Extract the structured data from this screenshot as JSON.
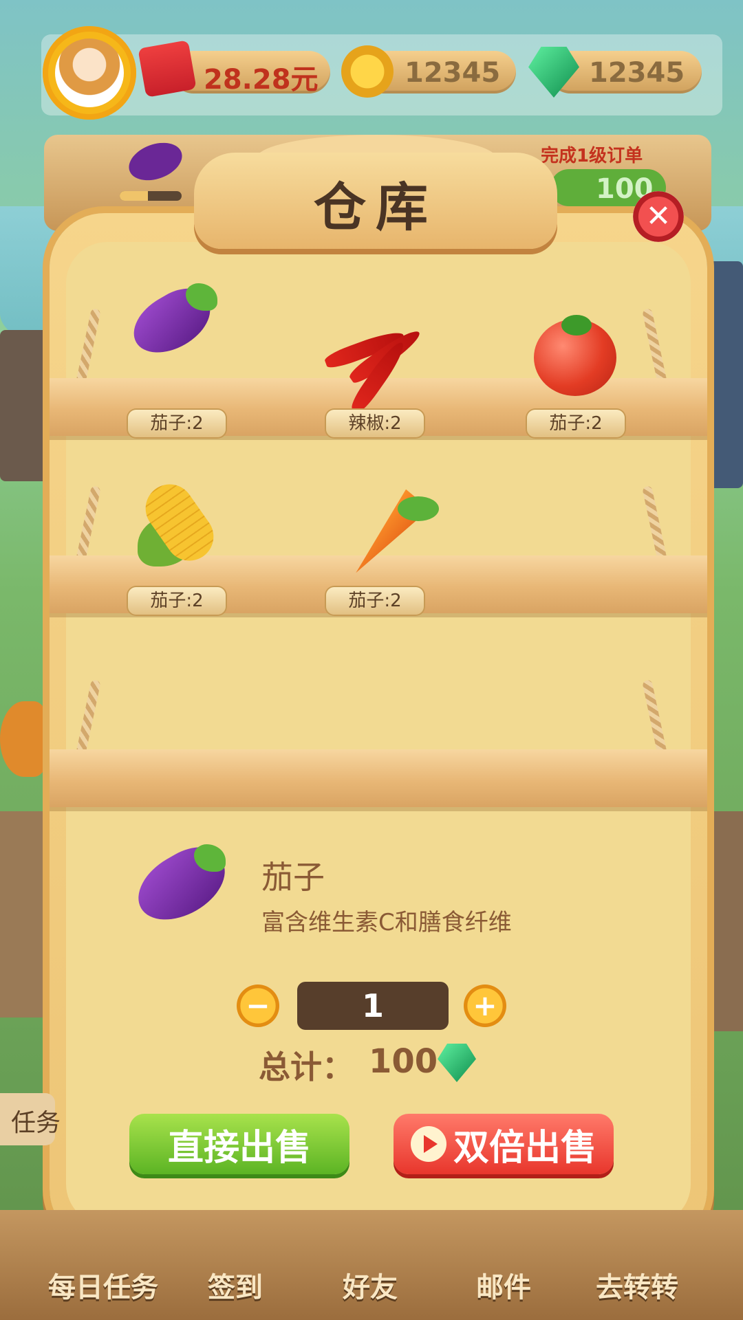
{
  "hud": {
    "money": "28.28元",
    "coins": "12345",
    "gems": "12345"
  },
  "order": {
    "text": "完成1级订单",
    "reward": "100",
    "progress": 0.45
  },
  "dialog": {
    "title": "仓库",
    "close_icon": "close-icon"
  },
  "shelves": [
    {
      "items": [
        {
          "icon": "eggplant-icon",
          "label": "茄子:2"
        },
        {
          "icon": "chili-icon",
          "label": "辣椒:2"
        },
        {
          "icon": "tomato-icon",
          "label": "茄子:2"
        }
      ]
    },
    {
      "items": [
        {
          "icon": "corn-icon",
          "label": "茄子:2"
        },
        {
          "icon": "carrot-icon",
          "label": "茄子:2"
        }
      ]
    },
    {
      "items": []
    }
  ],
  "detail": {
    "name": "茄子",
    "description": "富含维生素C和膳食纤维",
    "quantity": "1",
    "total_label": "总计：",
    "total_value": "100",
    "currency_icon": "gem-icon"
  },
  "actions": {
    "sell_direct": "直接出售",
    "sell_double": "双倍出售"
  },
  "side_tab": "任务",
  "bottom_nav": [
    "每日任务",
    "签到",
    "好友",
    "邮件",
    "去转转"
  ],
  "colors": {
    "panel": "#f2da92",
    "title_text": "#4a3424",
    "detail_text": "#8a5a35",
    "qty_box": "#573e2b",
    "btn_green": "#5cb424",
    "btn_red": "#e8362c"
  }
}
